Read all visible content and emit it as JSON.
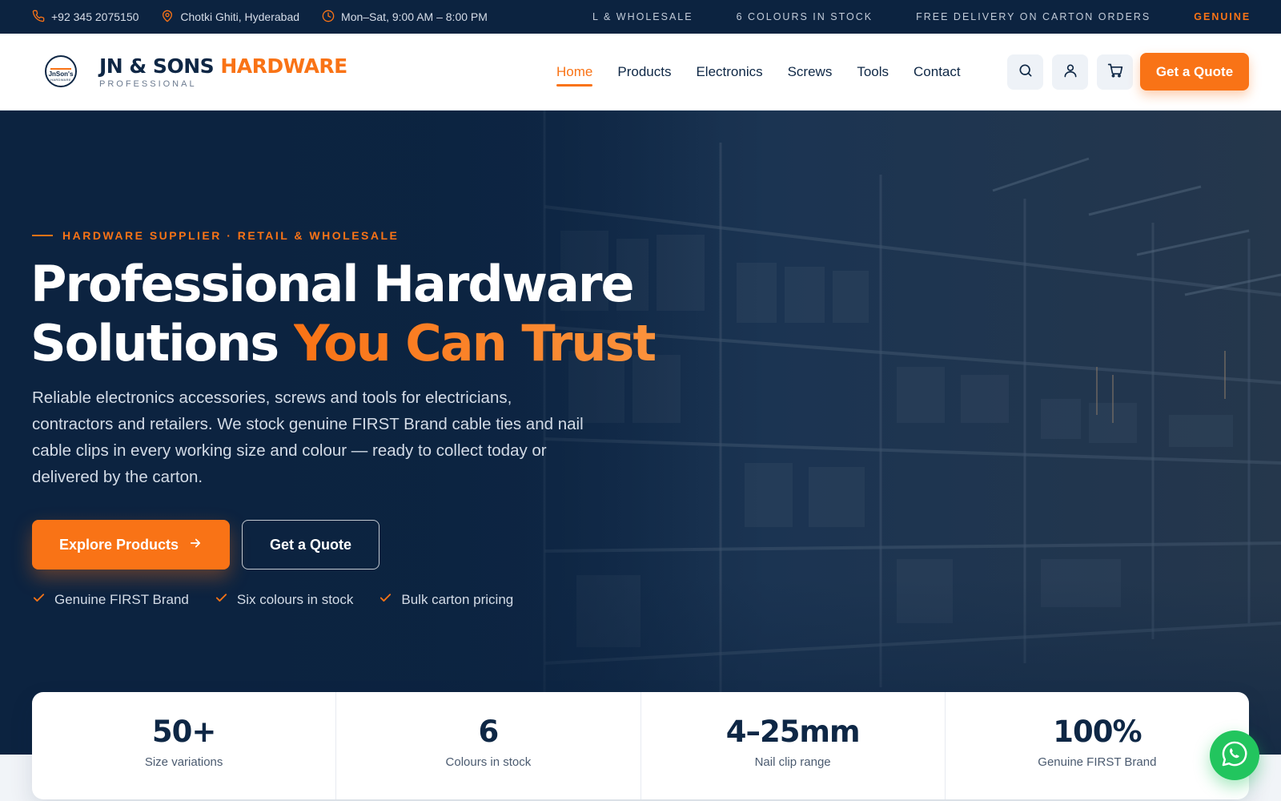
{
  "topbar": {
    "phone": "+92 345 2075150",
    "location": "Chotki Ghiti, Hyderabad",
    "hours": "Mon–Sat, 9:00 AM – 8:00 PM",
    "ticker": [
      "L & WHOLESALE",
      "6 COLOURS IN STOCK",
      "FREE DELIVERY ON CARTON ORDERS"
    ],
    "ticker_highlight": "GENUINE FIR"
  },
  "logo": {
    "badge_text": "JnSon's",
    "badge_sub": "HARDWARE"
  },
  "brand": {
    "name_part1": "JN & SONS",
    "name_part2": "HARDWARE",
    "tagline": "PROFESSIONAL"
  },
  "nav": {
    "items": [
      "Home",
      "Products",
      "Electronics",
      "Screws",
      "Tools",
      "Contact"
    ],
    "active": "Home"
  },
  "header": {
    "quote_label": "Get a Quote"
  },
  "hero": {
    "eyebrow": "HARDWARE SUPPLIER · RETAIL & WHOLESALE",
    "headline_line1": "Professional Hardware",
    "headline_line2_plain": "Solutions",
    "headline_line2_accent": "You Can Trust",
    "lede": "Reliable electronics accessories, screws and tools for electricians, contractors and retailers. We stock genuine FIRST Brand cable ties and nail cable clips in every working size and colour — ready to collect today or delivered by the carton.",
    "primary_cta": "Explore Products",
    "secondary_cta": "Get a Quote",
    "checks": [
      "Genuine FIRST Brand",
      "Six colours in stock",
      "Bulk carton pricing"
    ]
  },
  "stats": [
    {
      "value": "50+",
      "label": "Size variations"
    },
    {
      "value": "6",
      "label": "Colours in stock"
    },
    {
      "value": "4–25mm",
      "label": "Nail clip range"
    },
    {
      "value": "100%",
      "label": "Genuine FIRST Brand"
    }
  ],
  "colors": {
    "navy": "#0c2340",
    "accent": "#f97316",
    "whatsapp": "#22c55e"
  },
  "icons": {
    "phone": "phone-icon",
    "location": "map-pin-icon",
    "hours": "clock-icon",
    "search": "search-icon",
    "account": "user-icon",
    "cart": "cart-icon",
    "arrow": "arrow-right-icon",
    "check": "check-icon",
    "whatsapp": "whatsapp-icon"
  }
}
